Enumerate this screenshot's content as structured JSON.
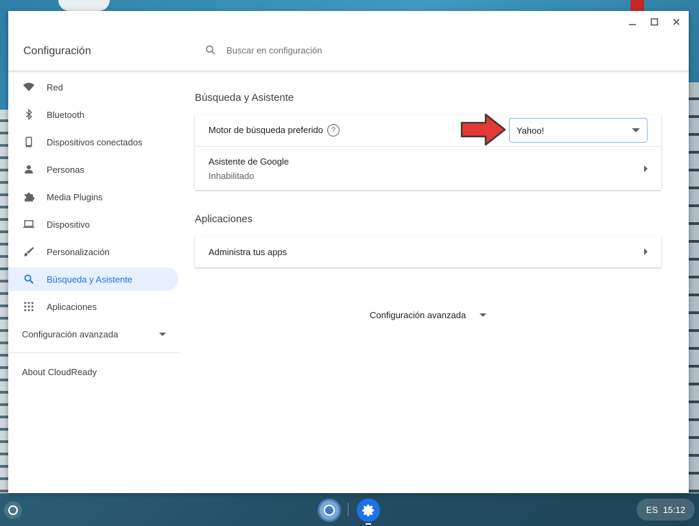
{
  "window": {
    "title": "Configuración",
    "controls": [
      "minimize",
      "maximize",
      "close"
    ]
  },
  "search": {
    "placeholder": "Buscar en configuración",
    "icon": "search-icon"
  },
  "sidebar": {
    "items": [
      {
        "label": "Red",
        "icon": "wifi-icon",
        "active": false
      },
      {
        "label": "Bluetooth",
        "icon": "bluetooth-icon",
        "active": false
      },
      {
        "label": "Dispositivos conectados",
        "icon": "phone-icon",
        "active": false
      },
      {
        "label": "Personas",
        "icon": "person-icon",
        "active": false
      },
      {
        "label": "Media Plugins",
        "icon": "puzzle-icon",
        "active": false
      },
      {
        "label": "Dispositivo",
        "icon": "laptop-icon",
        "active": false
      },
      {
        "label": "Personalización",
        "icon": "brush-icon",
        "active": false
      },
      {
        "label": "Búsqueda y Asistente",
        "icon": "search-icon",
        "active": true
      },
      {
        "label": "Aplicaciones",
        "icon": "apps-grid-icon",
        "active": false
      }
    ],
    "advanced_label": "Configuración avanzada",
    "about_label": "About CloudReady"
  },
  "main": {
    "sections": [
      {
        "title": "Búsqueda y Asistente",
        "rows": [
          {
            "label": "Motor de búsqueda preferido",
            "select_value": "Yahoo!"
          },
          {
            "label": "Asistente de Google",
            "sublabel": "Inhabilitado"
          }
        ]
      },
      {
        "title": "Aplicaciones",
        "rows": [
          {
            "label": "Administra tus apps"
          }
        ]
      }
    ],
    "advanced_label": "Configuración avanzada"
  },
  "taskbar": {
    "apps": [
      "chrome-icon",
      "settings-icon"
    ],
    "tray_text": "ES  15:12"
  },
  "colors": {
    "accent": "#1a73e8",
    "active_bg": "#e8f0fe",
    "arrow_red": "#e53935"
  }
}
